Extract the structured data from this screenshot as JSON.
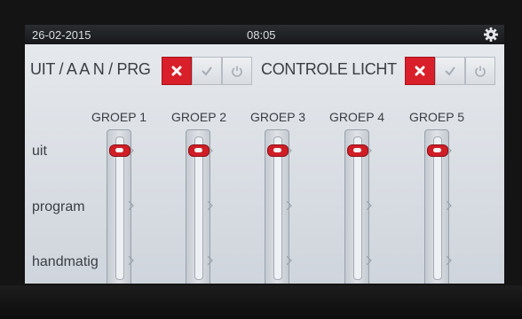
{
  "status": {
    "date": "26-02-2015",
    "time": "08:05",
    "settings_icon": "gear-icon"
  },
  "mode_control": {
    "label": "UIT / A A N / PRG",
    "buttons": [
      {
        "name": "off",
        "icon": "close-icon",
        "selected": true
      },
      {
        "name": "on",
        "icon": "check-icon",
        "selected": false
      },
      {
        "name": "program",
        "icon": "power-icon",
        "selected": false
      }
    ]
  },
  "light_control": {
    "label": "CONTROLE LICHT",
    "buttons": [
      {
        "name": "off",
        "icon": "close-icon",
        "selected": true
      },
      {
        "name": "on",
        "icon": "check-icon",
        "selected": false
      },
      {
        "name": "program",
        "icon": "power-icon",
        "selected": false
      }
    ]
  },
  "positions": [
    "uit",
    "program",
    "handmatig"
  ],
  "groups": [
    {
      "label": "GROEP 1",
      "position": "uit"
    },
    {
      "label": "GROEP 2",
      "position": "uit"
    },
    {
      "label": "GROEP 3",
      "position": "uit"
    },
    {
      "label": "GROEP 4",
      "position": "uit"
    },
    {
      "label": "GROEP 5",
      "position": "uit"
    }
  ],
  "colors": {
    "active": "#d81f2a",
    "statusbar": "#1e2023",
    "screen": "#dde1e6"
  }
}
